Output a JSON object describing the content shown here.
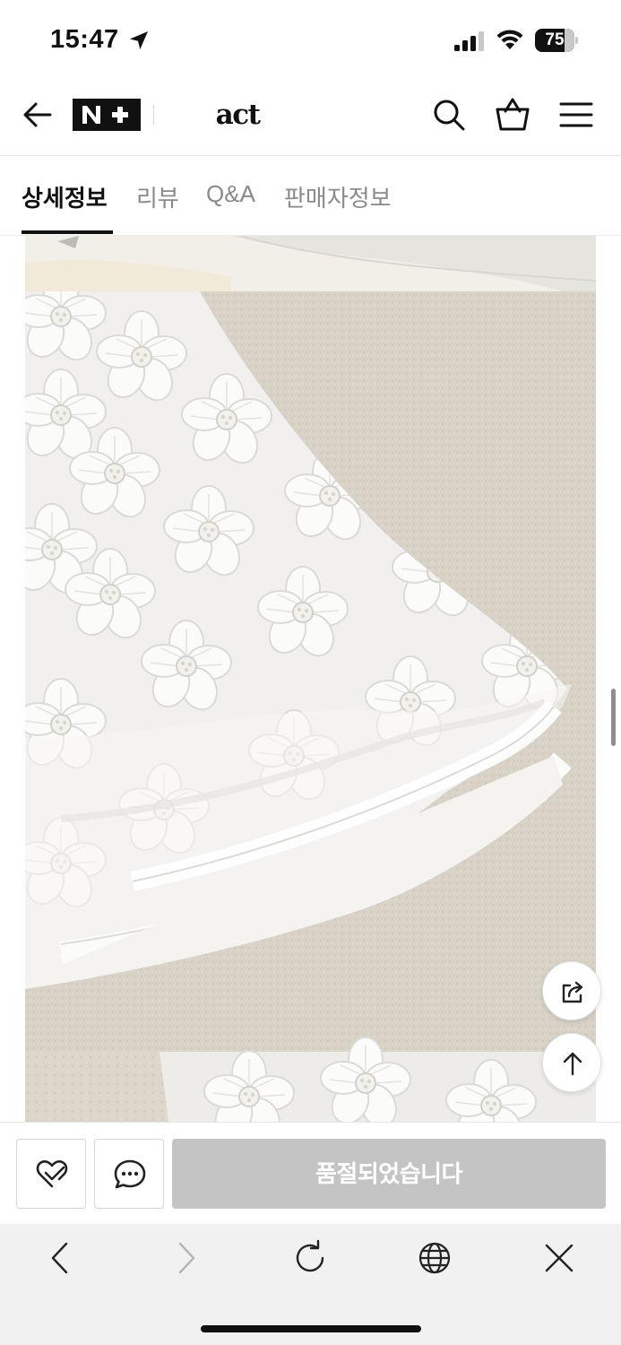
{
  "status_bar": {
    "time": "15:47",
    "battery_percent": "75",
    "battery_level": 0.75
  },
  "header": {
    "nplus_logo_text": "N+",
    "brand_name": "act",
    "icons": [
      "back-arrow-icon",
      "search-icon",
      "shopping-bag-icon",
      "hamburger-menu-icon"
    ]
  },
  "tabs": [
    {
      "label": "상세정보",
      "active": true
    },
    {
      "label": "리뷰",
      "active": false
    },
    {
      "label": "Q&A",
      "active": false
    },
    {
      "label": "판매자정보",
      "active": false
    }
  ],
  "content": {
    "image_subject": "white floral embroidered organza fabric on beige carpet"
  },
  "floating": {
    "share_icon": "share-icon",
    "top_icon": "arrow-up-icon"
  },
  "buy_bar": {
    "soldout_label": "품절되었습니다",
    "wish_icon": "heart-check-icon",
    "talk_icon": "chat-bubble-icon"
  },
  "browser_toolbar": {
    "icons": [
      "back-chevron-icon",
      "forward-chevron-icon",
      "refresh-icon",
      "globe-icon",
      "close-icon"
    ]
  },
  "colors": {
    "soldout_bg": "#c4c4c4",
    "carpet": "#d9d3c8",
    "fabric": "#f4f3f1",
    "toolbar_bg": "#f1f1f1"
  }
}
